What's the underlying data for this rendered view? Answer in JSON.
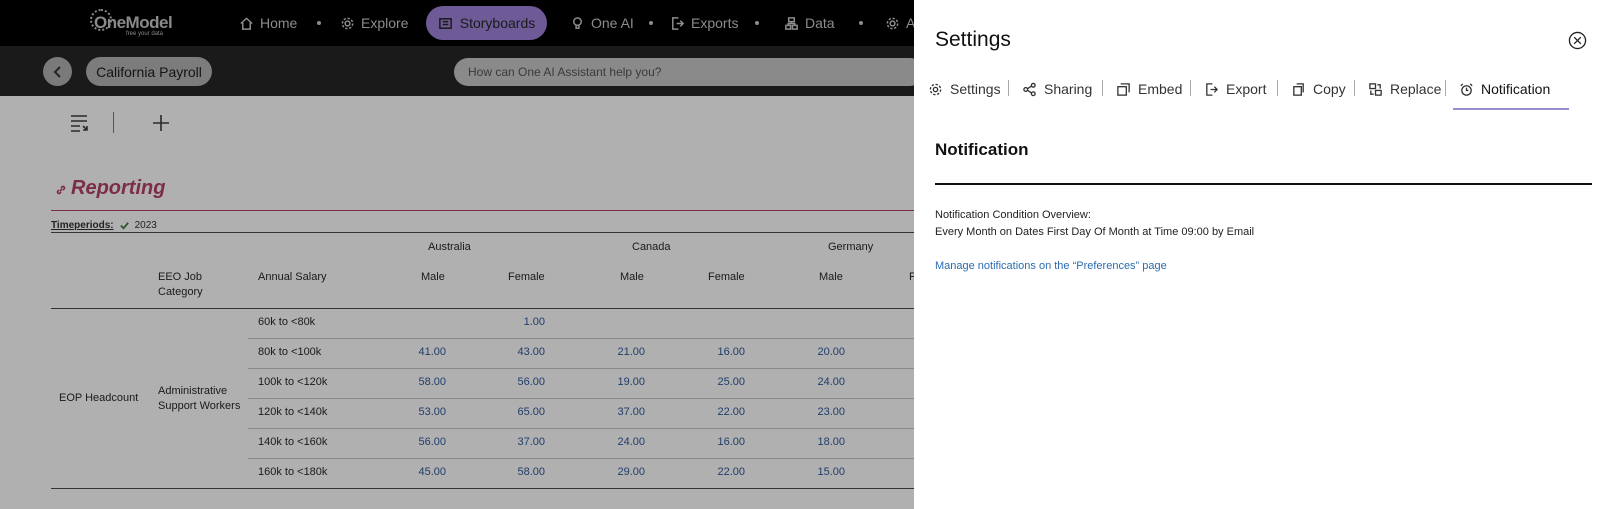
{
  "nav": {
    "logo_name": "OneModel",
    "logo_tagline": "free your data",
    "items": [
      {
        "label": "Home",
        "icon": "home-icon"
      },
      {
        "label": "Explore",
        "icon": "gear-icon"
      },
      {
        "label": "Storyboards",
        "icon": "storyboard-icon",
        "active": true
      },
      {
        "label": "One AI",
        "icon": "bulb-icon"
      },
      {
        "label": "Exports",
        "icon": "export-icon"
      },
      {
        "label": "Data",
        "icon": "data-icon"
      },
      {
        "label": "A",
        "icon": "gear-icon"
      }
    ]
  },
  "subbar": {
    "page_chip": "California Payroll",
    "ai_placeholder": "How can One AI Assistant help you?"
  },
  "report": {
    "title": "Reporting",
    "timeperiods_label": "Timeperiods:",
    "timeperiod_value": "2023",
    "headers": {
      "eeo": "EEO Job Category",
      "salary": "Annual Salary",
      "countries": [
        "Australia",
        "Canada",
        "Germany"
      ],
      "male": "Male",
      "female": "Female",
      "female_cut": "F"
    },
    "metric": "EOP Headcount",
    "category": "Administrative Support Workers",
    "rows": [
      {
        "band": "60k to <80k",
        "values": [
          "",
          "1.00",
          "",
          "",
          ""
        ]
      },
      {
        "band": "80k to <100k",
        "values": [
          "41.00",
          "43.00",
          "21.00",
          "16.00",
          "20.00"
        ]
      },
      {
        "band": "100k to <120k",
        "values": [
          "58.00",
          "56.00",
          "19.00",
          "25.00",
          "24.00"
        ]
      },
      {
        "band": "120k to <140k",
        "values": [
          "53.00",
          "65.00",
          "37.00",
          "22.00",
          "23.00"
        ]
      },
      {
        "band": "140k to <160k",
        "values": [
          "56.00",
          "37.00",
          "24.00",
          "16.00",
          "18.00"
        ]
      },
      {
        "band": "160k to <180k",
        "values": [
          "45.00",
          "58.00",
          "29.00",
          "22.00",
          "15.00"
        ]
      }
    ]
  },
  "panel": {
    "title": "Settings",
    "tabs": [
      {
        "label": "Settings",
        "icon": "gear-icon"
      },
      {
        "label": "Sharing",
        "icon": "share-icon"
      },
      {
        "label": "Embed",
        "icon": "embed-icon"
      },
      {
        "label": "Export",
        "icon": "export-icon"
      },
      {
        "label": "Copy",
        "icon": "copy-icon"
      },
      {
        "label": "Replace",
        "icon": "replace-icon"
      },
      {
        "label": "Notification",
        "icon": "alarm-icon",
        "active": true
      }
    ],
    "notification": {
      "heading": "Notification",
      "overview_label": "Notification Condition Overview:",
      "overview_text": "Every Month on Dates First Day Of Month at Time 09:00 by Email",
      "manage_link": "Manage notifications on the “Preferences” page"
    }
  }
}
